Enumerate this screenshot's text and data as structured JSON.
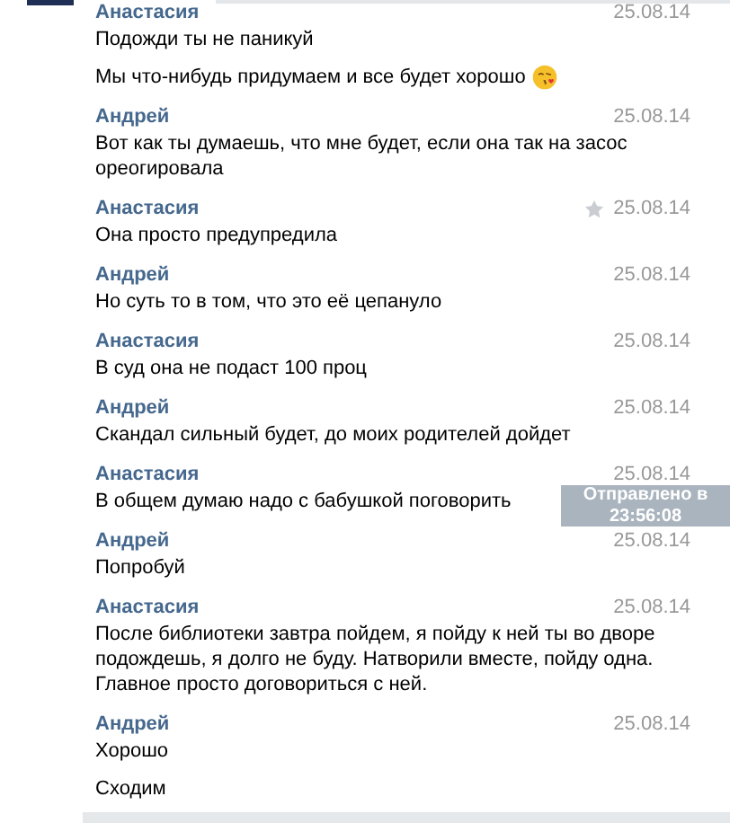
{
  "groups": [
    {
      "author": "Анастасия",
      "date": "25.08.14",
      "starred": false,
      "messages": [
        {
          "lines": [
            "Подожди ты не паникуй"
          ],
          "emoji": false
        },
        {
          "lines": [
            "Мы что-нибудь придумаем и все будет хорошо"
          ],
          "emoji": true
        }
      ]
    },
    {
      "author": "Андрей",
      "date": "25.08.14",
      "starred": false,
      "messages": [
        {
          "lines": [
            "Вот как ты думаешь, что мне будет, если она так на засос",
            "ореогировала"
          ],
          "emoji": false
        }
      ]
    },
    {
      "author": "Анастасия",
      "date": "25.08.14",
      "starred": true,
      "messages": [
        {
          "lines": [
            "Она просто предупредила"
          ],
          "emoji": false
        }
      ]
    },
    {
      "author": "Андрей",
      "date": "25.08.14",
      "starred": false,
      "messages": [
        {
          "lines": [
            "Но суть то в том, что это её цепануло"
          ],
          "emoji": false
        }
      ]
    },
    {
      "author": "Анастасия",
      "date": "25.08.14",
      "starred": false,
      "messages": [
        {
          "lines": [
            "В суд она не подаст 100 проц"
          ],
          "emoji": false
        }
      ]
    },
    {
      "author": "Андрей",
      "date": "25.08.14",
      "starred": false,
      "messages": [
        {
          "lines": [
            "Скандал сильный будет, до моих родителей дойдет"
          ],
          "emoji": false
        }
      ]
    },
    {
      "author": "Анастасия",
      "date": "25.08.14",
      "starred": false,
      "messages": [
        {
          "lines": [
            "В общем думаю надо с бабушкой поговорить"
          ],
          "emoji": false
        }
      ]
    },
    {
      "author": "Андрей",
      "date": "25.08.14",
      "starred": false,
      "messages": [
        {
          "lines": [
            "Попробуй"
          ],
          "emoji": false
        }
      ]
    },
    {
      "author": "Анастасия",
      "date": "25.08.14",
      "starred": false,
      "messages": [
        {
          "lines": [
            "После библиотеки завтра пойдем, я пойду к ней ты во дворе",
            "подождешь, я долго не буду. Натворили вместе, пойду одна.",
            "Главное просто договориться с ней."
          ],
          "emoji": false
        }
      ]
    },
    {
      "author": "Андрей",
      "date": "25.08.14",
      "starred": false,
      "messages": [
        {
          "lines": [
            "Хорошо"
          ],
          "emoji": false
        },
        {
          "lines": [
            "Сходим"
          ],
          "emoji": false
        }
      ]
    }
  ],
  "tooltip": {
    "lines": [
      "Отправлено в",
      "23:56:08"
    ]
  }
}
